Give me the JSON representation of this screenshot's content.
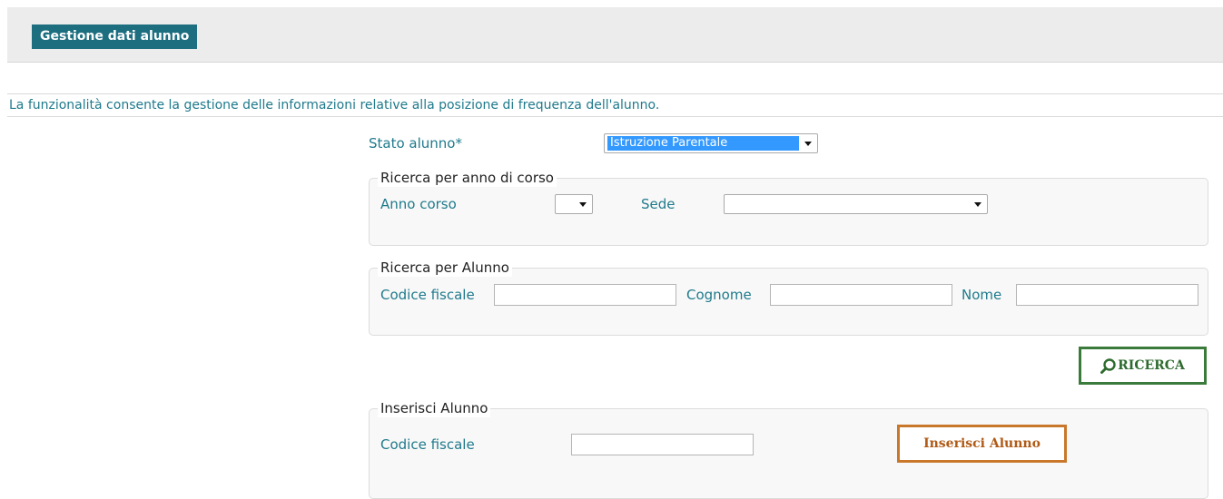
{
  "header": {
    "title": "Gestione dati alunno"
  },
  "description": "La funzionalità consente la gestione delle informazioni relative alla posizione di frequenza dell'alunno.",
  "stato": {
    "label": "Stato alunno*",
    "value": "Istruzione Parentale"
  },
  "ricerca_anno": {
    "legend": "Ricerca per anno di corso",
    "anno_label": "Anno corso",
    "anno_value": "",
    "sede_label": "Sede",
    "sede_value": ""
  },
  "ricerca_alunno": {
    "legend": "Ricerca per Alunno",
    "codice_label": "Codice fiscale",
    "cognome_label": "Cognome",
    "nome_label": "Nome"
  },
  "search_button": {
    "label": "RICERCA",
    "icon": "search-icon",
    "color": "#3a7a3a"
  },
  "inserisci": {
    "legend": "Inserisci Alunno",
    "codice_label": "Codice fiscale",
    "button_label": "Inserisci Alunno",
    "button_color": "#c9782b"
  },
  "colors": {
    "accent": "#1d6f80",
    "label": "#1f7a8c"
  }
}
